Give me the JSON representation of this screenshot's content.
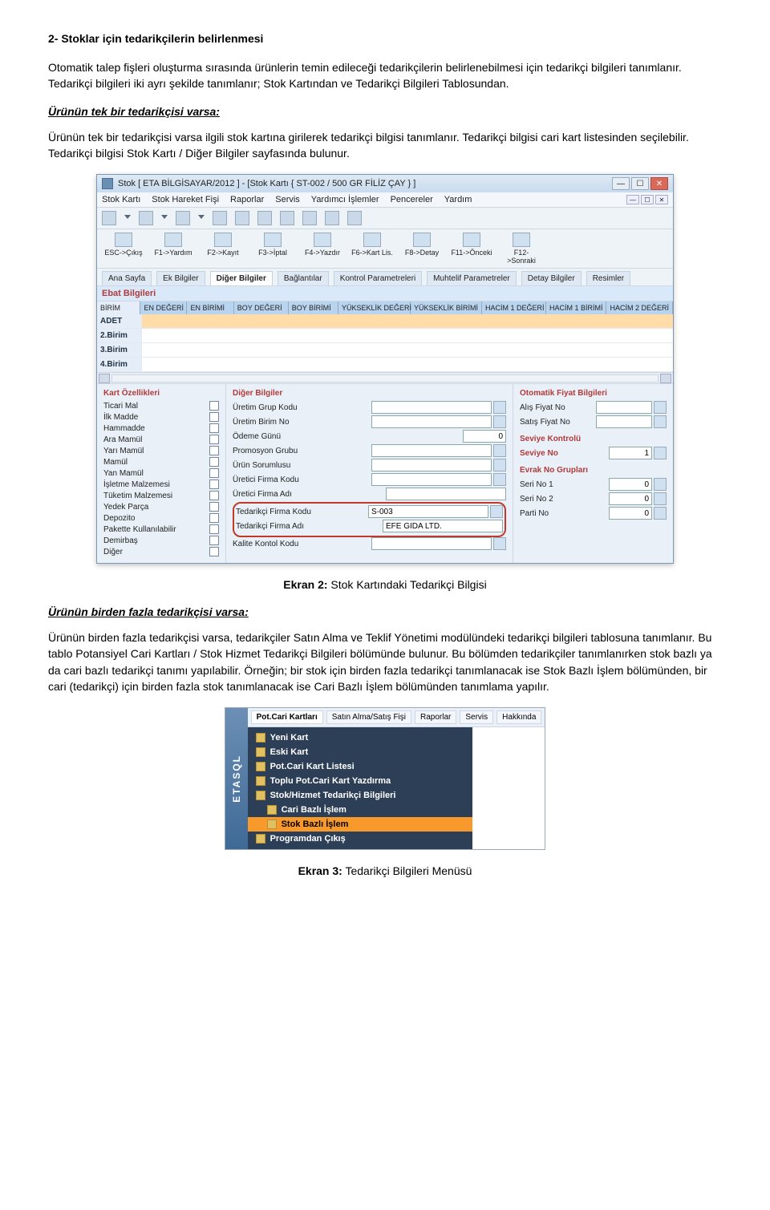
{
  "heading_2": "2- Stoklar için tedarikçilerin belirlenmesi",
  "p1": "Otomatik talep fişleri oluşturma sırasında ürünlerin temin edileceği tedarikçilerin belirlenebilmesi için tedarikçi bilgileri tanımlanır. Tedarikçi bilgileri iki ayrı şekilde tanımlanır; Stok Kartından ve Tedarikçi Bilgileri Tablosundan.",
  "sub1": "Ürünün tek bir tedarikçisi varsa:",
  "p2": "Ürünün tek bir tedarikçisi varsa ilgili stok kartına girilerek tedarikçi bilgisi tanımlanır. Tedarikçi bilgisi cari kart listesinden seçilebilir. Tedarikçi bilgisi Stok Kartı / Diğer Bilgiler sayfasında bulunur.",
  "caption2_bold": "Ekran 2:",
  "caption2_rest": " Stok Kartındaki Tedarikçi Bilgisi",
  "sub2": "Ürünün birden fazla tedarikçisi varsa:",
  "p3": "Ürünün birden fazla tedarikçisi varsa, tedarikçiler Satın Alma ve Teklif Yönetimi modülündeki tedarikçi bilgileri tablosuna tanımlanır. Bu tablo Potansiyel Cari Kartları / Stok Hizmet Tedarikçi Bilgileri bölümünde bulunur. Bu bölümden tedarikçiler tanımlanırken stok bazlı ya da cari bazlı tedarikçi tanımı yapılabilir. Örneğin; bir stok için birden fazla tedarikçi tanımlanacak ise Stok Bazlı İşlem bölümünden, bir cari (tedarikçi) için birden fazla stok tanımlanacak ise Cari Bazlı İşlem bölümünden tanımlama yapılır.",
  "caption3_bold": "Ekran 3:",
  "caption3_rest": " Tedarikçi Bilgileri Menüsü",
  "win": {
    "title": "Stok [ ETA BİLGİSAYAR/2012 ]  - [Stok Kartı { ST-002 / 500 GR FİLİZ ÇAY } ]",
    "menu": [
      "Stok Kartı",
      "Stok Hareket Fişi",
      "Raporlar",
      "Servis",
      "Yardımcı İşlemler",
      "Pencereler",
      "Yardım"
    ],
    "fn": [
      {
        "k": "ESC->Çıkış"
      },
      {
        "k": "F1->Yardım"
      },
      {
        "k": "F2->Kayıt"
      },
      {
        "k": "F3->İptal"
      },
      {
        "k": "F4->Yazdır"
      },
      {
        "k": "F6->Kart Lis."
      },
      {
        "k": "F8->Detay"
      },
      {
        "k": "F11->Önceki"
      },
      {
        "k": "F12->Sonraki"
      }
    ],
    "tabs": [
      "Ana Sayfa",
      "Ek Bilgiler",
      "Diğer Bilgiler",
      "Bağlantılar",
      "Kontrol Parametreleri",
      "Muhtelif Parametreler",
      "Detay Bilgiler",
      "Resimler"
    ],
    "section": "Ebat Bilgileri",
    "grid_headers": [
      "BİRİM",
      "EN DEĞERİ",
      "EN BİRİMİ",
      "BOY DEĞERİ",
      "BOY BİRİMİ",
      "YÜKSEKLİK DEĞERİ",
      "YÜKSEKLİK BİRİMİ",
      "HACİM 1 DEĞERİ",
      "HACİM 1 BİRİMİ",
      "HACİM 2 DEĞERİ"
    ],
    "grid_rows": [
      "ADET",
      "2.Birim",
      "3.Birim",
      "4.Birim"
    ],
    "col1_title": "Kart Özellikleri",
    "col1_items": [
      "Ticari Mal",
      "İlk Madde",
      "Hammadde",
      "Ara Mamül",
      "Yarı Mamül",
      "Mamül",
      "Yan Mamül",
      "İşletme Malzemesi",
      "Tüketim Malzemesi",
      "Yedek Parça",
      "Depozito",
      "Pakette Kullanılabilir",
      "Demirbaş",
      "Diğer"
    ],
    "col2_title": "Diğer Bilgiler",
    "col2_fields": {
      "uretim_grup": "Üretim Grup Kodu",
      "uretim_birim": "Üretim Birim No",
      "odeme_gunu": "Ödeme Günü",
      "odeme_gunu_val": "0",
      "promosyon": "Promosyon Grubu",
      "urun_sorumlu": "Ürün Sorumlusu",
      "uretici_kod": "Üretici Firma Kodu",
      "uretici_ad": "Üretici Firma Adı",
      "tedarik_kod": "Tedarikçi Firma Kodu",
      "tedarik_kod_val": "S-003",
      "tedarik_ad": "Tedarikçi Firma Adı",
      "tedarik_ad_val": "EFE GIDA LTD.",
      "kalite": "Kalite Kontol Kodu"
    },
    "col3_title_a": "Otomatik Fiyat Bilgileri",
    "col3_a": {
      "alis": "Alış Fiyat No",
      "satis": "Satış Fiyat No"
    },
    "col3_title_b": "Seviye Kontrolü",
    "col3_b": {
      "seviye": "Seviye No",
      "seviye_val": "1"
    },
    "col3_title_c": "Evrak No Grupları",
    "col3_c": {
      "seri1": "Seri No 1",
      "seri1_v": "0",
      "seri2": "Seri No 2",
      "seri2_v": "0",
      "parti": "Parti No",
      "parti_v": "0"
    }
  },
  "menu2": {
    "sidebar": "ETASQL",
    "tabs": [
      "Pot.Cari Kartları",
      "Satın Alma/Satış Fişi",
      "Raporlar",
      "Servis",
      "Hakkında"
    ],
    "items": [
      {
        "t": "Yeni Kart",
        "i": 0
      },
      {
        "t": "Eski Kart",
        "i": 0
      },
      {
        "t": "Pot.Cari Kart Listesi",
        "i": 0
      },
      {
        "t": "Toplu Pot.Cari Kart Yazdırma",
        "i": 0
      },
      {
        "t": "Stok/Hizmet Tedarikçi Bilgileri",
        "i": 0
      },
      {
        "t": "Cari Bazlı İşlem",
        "i": 1
      },
      {
        "t": "Stok Bazlı İşlem",
        "i": 1,
        "hl": true
      },
      {
        "t": "Programdan Çıkış",
        "i": 0
      }
    ]
  }
}
